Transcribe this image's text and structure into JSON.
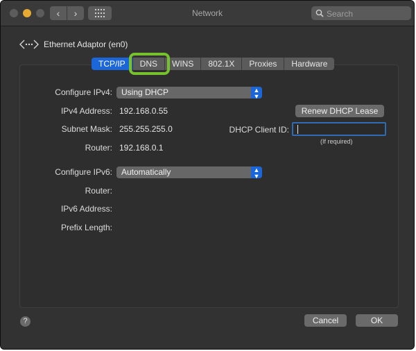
{
  "window": {
    "title": "Network"
  },
  "toolbar": {
    "back_glyph": "‹",
    "forward_glyph": "›",
    "search_placeholder": "Search"
  },
  "header": {
    "adaptor_title": "Ethernet Adaptor (en0)"
  },
  "tabs": [
    {
      "label": "TCP/IP",
      "active": true
    },
    {
      "label": "DNS",
      "highlighted": true
    },
    {
      "label": "WINS"
    },
    {
      "label": "802.1X"
    },
    {
      "label": "Proxies"
    },
    {
      "label": "Hardware"
    }
  ],
  "ipv4": {
    "configure_label": "Configure IPv4:",
    "configure_value": "Using DHCP",
    "address_label": "IPv4 Address:",
    "address_value": "192.168.0.55",
    "subnet_label": "Subnet Mask:",
    "subnet_value": "255.255.255.0",
    "router_label": "Router:",
    "router_value": "192.168.0.1"
  },
  "dhcp": {
    "renew_button": "Renew DHCP Lease",
    "client_id_label": "DHCP Client ID:",
    "client_id_value": "",
    "client_id_hint": "(If required)"
  },
  "ipv6": {
    "configure_label": "Configure IPv6:",
    "configure_value": "Automatically",
    "router_label": "Router:",
    "address_label": "IPv6 Address:",
    "prefix_label": "Prefix Length:"
  },
  "footer": {
    "help_glyph": "?",
    "cancel_button": "Cancel",
    "ok_button": "OK"
  },
  "colors": {
    "accent": "#1b66d9",
    "highlight_ring": "#75c22c",
    "focus_ring": "#2f6cb5"
  }
}
